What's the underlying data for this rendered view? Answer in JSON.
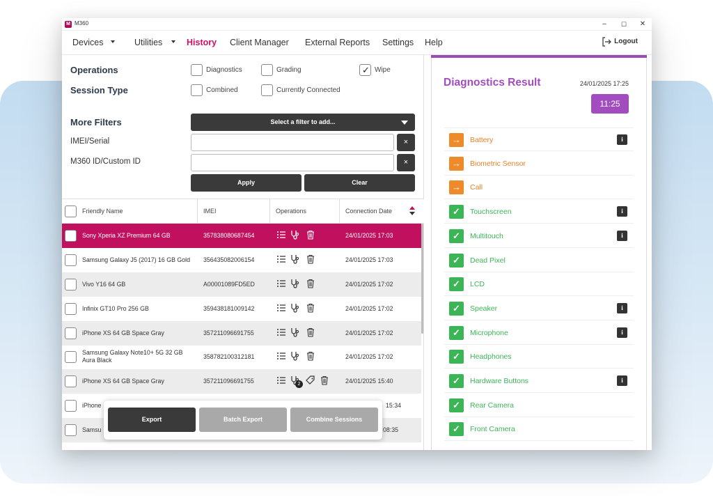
{
  "window": {
    "title": "M360",
    "logo_letter": "M",
    "controls": [
      "–",
      "☐",
      "✕"
    ]
  },
  "menu": {
    "items": [
      {
        "label": "Devices",
        "has_caret": true
      },
      {
        "label": "Utilities",
        "has_caret": true
      },
      {
        "label": "History",
        "active": true
      },
      {
        "label": "Client Manager"
      },
      {
        "label": "External Reports"
      },
      {
        "label": "Settings"
      },
      {
        "label": "Help"
      }
    ],
    "logout": "Logout"
  },
  "filters": {
    "operations_label": "Operations",
    "session_type_label": "Session Type",
    "operations": [
      {
        "label": "Diagnostics",
        "checked": false
      },
      {
        "label": "Grading",
        "checked": false
      },
      {
        "label": "Wipe",
        "checked": true
      }
    ],
    "session_types": [
      {
        "label": "Combined",
        "checked": false
      },
      {
        "label": "Currently Connected",
        "checked": false
      }
    ],
    "more_filters_label": "More Filters",
    "select_placeholder": "Select a filter to add...",
    "imei_label": "IMEI/Serial",
    "m360_label": "M360 ID/Custom ID",
    "clear_x": "×",
    "apply": "Apply",
    "clear": "Clear"
  },
  "table": {
    "headers": {
      "name": "Friendly Name",
      "imei": "IMEI",
      "operations": "Operations",
      "date": "Connection Date"
    },
    "rows": [
      {
        "name": "Sony Xperia XZ Premium 64 GB",
        "imei": "357838080687454",
        "date": "24/01/2025 17:03"
      },
      {
        "name": "Samsung Galaxy J5 (2017) 16 GB Gold",
        "imei": "356435082006154",
        "date": "24/01/2025 17:03"
      },
      {
        "name": "Vivo Y16 64 GB",
        "imei": "A00001089FD5ED",
        "date": "24/01/2025 17:02"
      },
      {
        "name": "Infinix GT10 Pro 256 GB",
        "imei": "359438181009142",
        "date": "24/01/2025 17:02"
      },
      {
        "name": "iPhone XS 64 GB Space Gray",
        "imei": "357211096691755",
        "date": "24/01/2025 17:02"
      },
      {
        "name": "Samsung Galaxy Note10+ 5G 32 GB Aura Black",
        "imei": "358782100312181",
        "date": "24/01/2025 17:02"
      },
      {
        "name": "iPhone XS 64 GB Space Gray",
        "imei": "357211096691755",
        "date": "24/01/2025 15:40",
        "badge": "2"
      },
      {
        "name": "iPhone",
        "imei": "",
        "date": "15:34"
      },
      {
        "name": "Samsu",
        "imei": "",
        "date": "08:35"
      }
    ]
  },
  "actions": {
    "export": "Export",
    "batch_export": "Batch Export",
    "combine": "Combine Sessions"
  },
  "diagnostics": {
    "title": "Diagnostics Result",
    "date": "24/01/2025 17:25",
    "time": "11:25",
    "info_glyph": "i",
    "tests": [
      {
        "name": "Battery",
        "status": "warn",
        "info": true
      },
      {
        "name": "Biometric Sensor",
        "status": "warn",
        "info": false
      },
      {
        "name": "Call",
        "status": "warn",
        "info": false
      },
      {
        "name": "Touchscreen",
        "status": "pass",
        "info": true
      },
      {
        "name": "Multitouch",
        "status": "pass",
        "info": true
      },
      {
        "name": "Dead Pixel",
        "status": "pass",
        "info": false
      },
      {
        "name": "LCD",
        "status": "pass",
        "info": false
      },
      {
        "name": "Speaker",
        "status": "pass",
        "info": true
      },
      {
        "name": "Microphone",
        "status": "pass",
        "info": true
      },
      {
        "name": "Headphones",
        "status": "pass",
        "info": false
      },
      {
        "name": "Hardware Buttons",
        "status": "pass",
        "info": true
      },
      {
        "name": "Rear Camera",
        "status": "pass",
        "info": false
      },
      {
        "name": "Front Camera",
        "status": "pass",
        "info": false
      }
    ]
  },
  "colors": {
    "accent": "#d00f66",
    "selected_row": "#c0105e",
    "purple": "#a24cc0",
    "warn": "#ef8a2a",
    "pass": "#3bb556",
    "dark_button": "#3a3a3a"
  }
}
